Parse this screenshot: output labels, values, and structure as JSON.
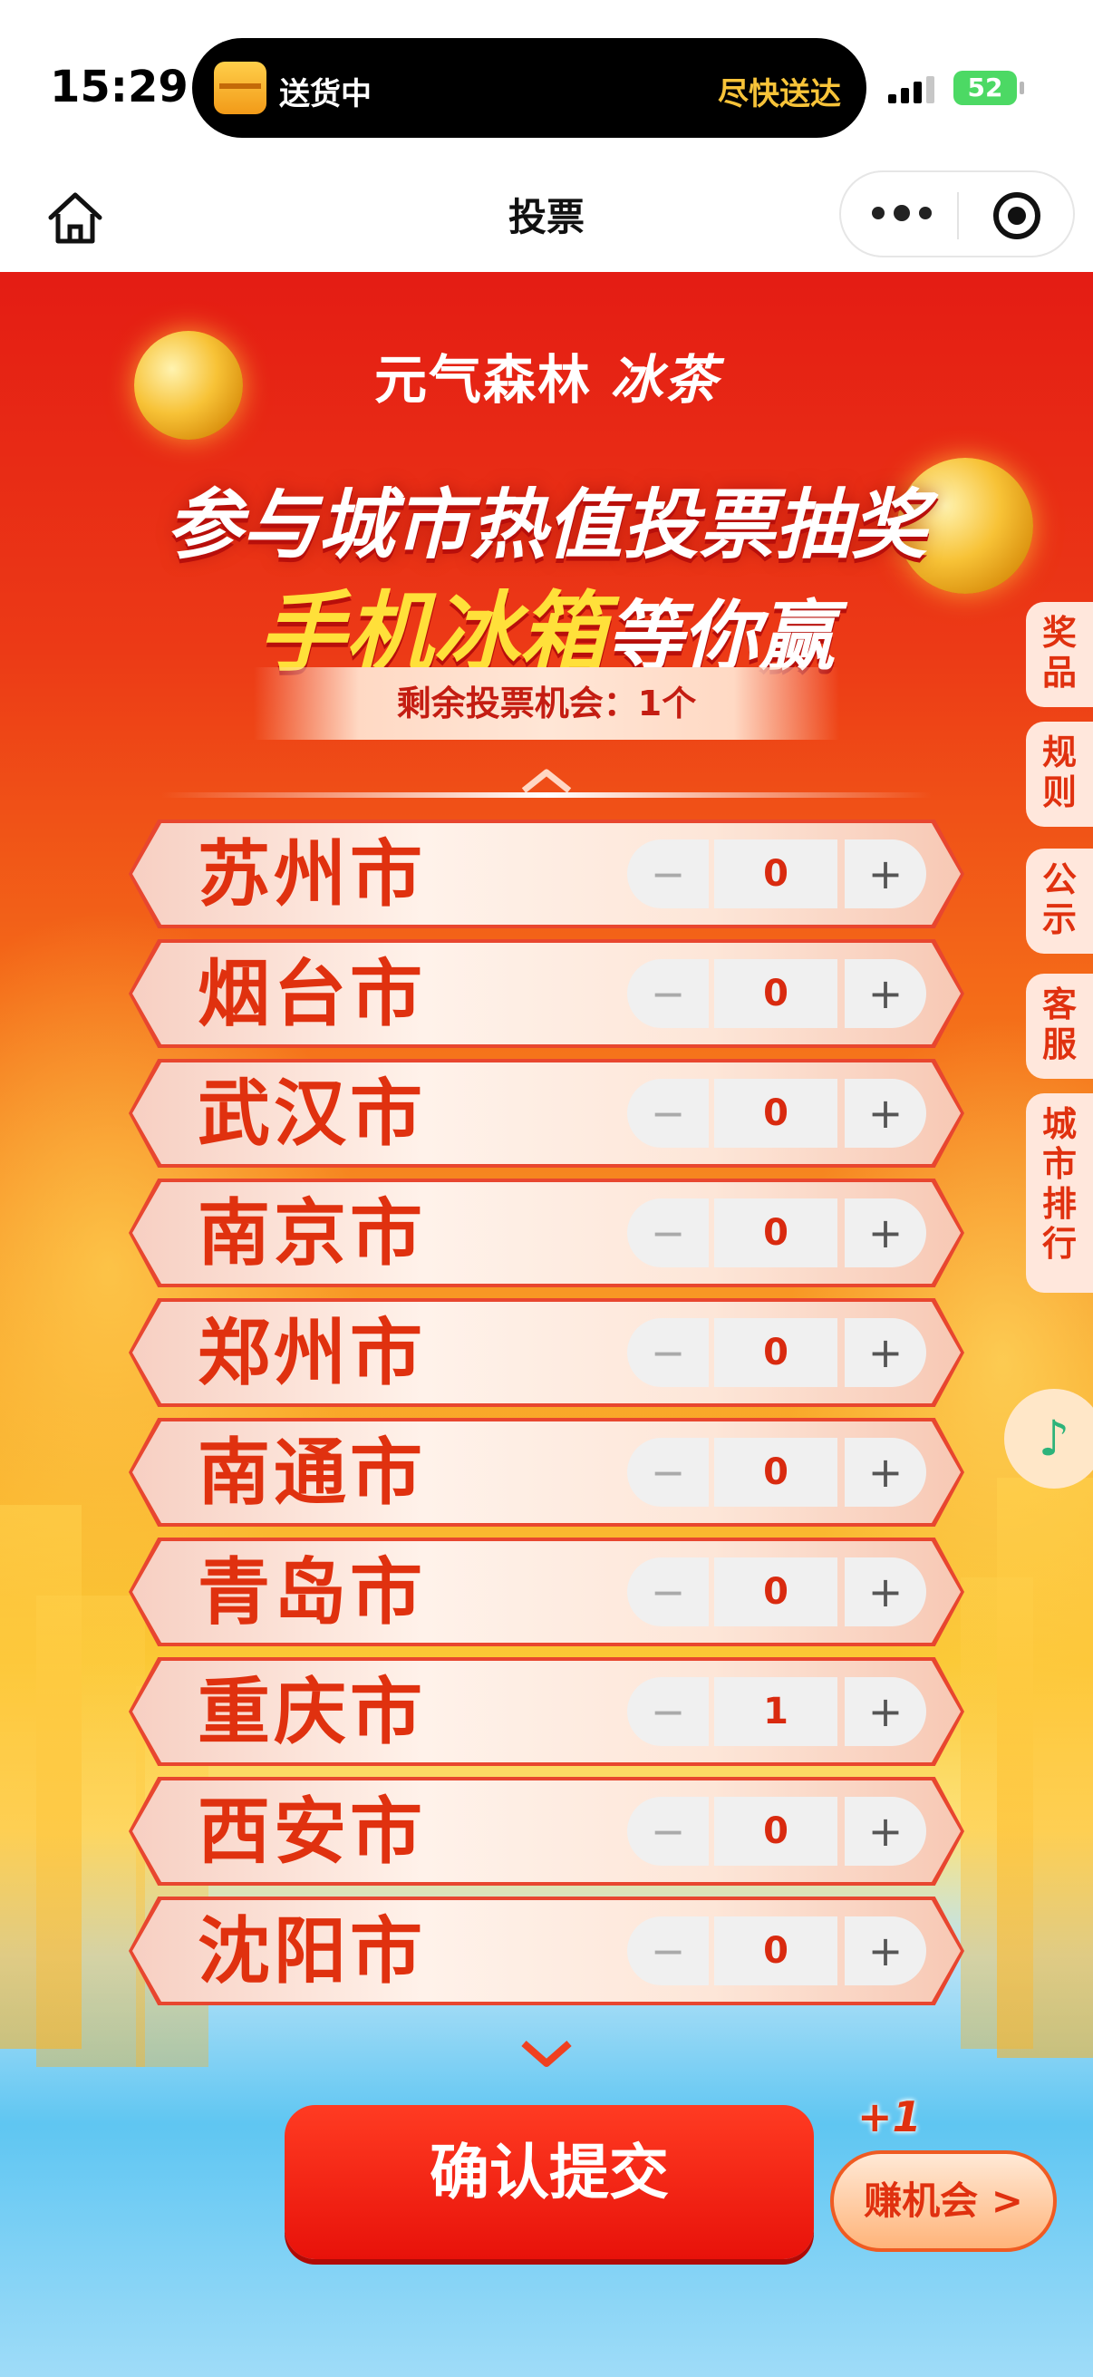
{
  "status_bar": {
    "time": "15:29",
    "island_label": "送货中",
    "island_right": "尽快送达",
    "battery": "52"
  },
  "nav": {
    "title": "投票"
  },
  "banner": {
    "brand_left": "元气森林",
    "brand_right": "冰茶",
    "headline_line1": "参与城市热值投票抽奖",
    "headline_highlight": "手机冰箱",
    "headline_rest": "等你赢",
    "remaining_votes": "剩余投票机会：1个"
  },
  "cities": [
    {
      "name": "苏州市",
      "votes": "0"
    },
    {
      "name": "烟台市",
      "votes": "0"
    },
    {
      "name": "武汉市",
      "votes": "0"
    },
    {
      "name": "南京市",
      "votes": "0"
    },
    {
      "name": "郑州市",
      "votes": "0"
    },
    {
      "name": "南通市",
      "votes": "0"
    },
    {
      "name": "青岛市",
      "votes": "0"
    },
    {
      "name": "重庆市",
      "votes": "1"
    },
    {
      "name": "西安市",
      "votes": "0"
    },
    {
      "name": "沈阳市",
      "votes": "0"
    }
  ],
  "stepper": {
    "minus": "−",
    "plus": "+"
  },
  "side_tabs": [
    "奖品",
    "规则",
    "公示",
    "客服",
    "城市排行"
  ],
  "music_icon": "♪",
  "actions": {
    "submit": "确认提交",
    "earn_badge": "+1",
    "earn": "赚机会 >"
  },
  "colors": {
    "accent_red": "#e0310f",
    "submit_red": "#e8120a",
    "highlight_yellow": "#ffe03a"
  }
}
